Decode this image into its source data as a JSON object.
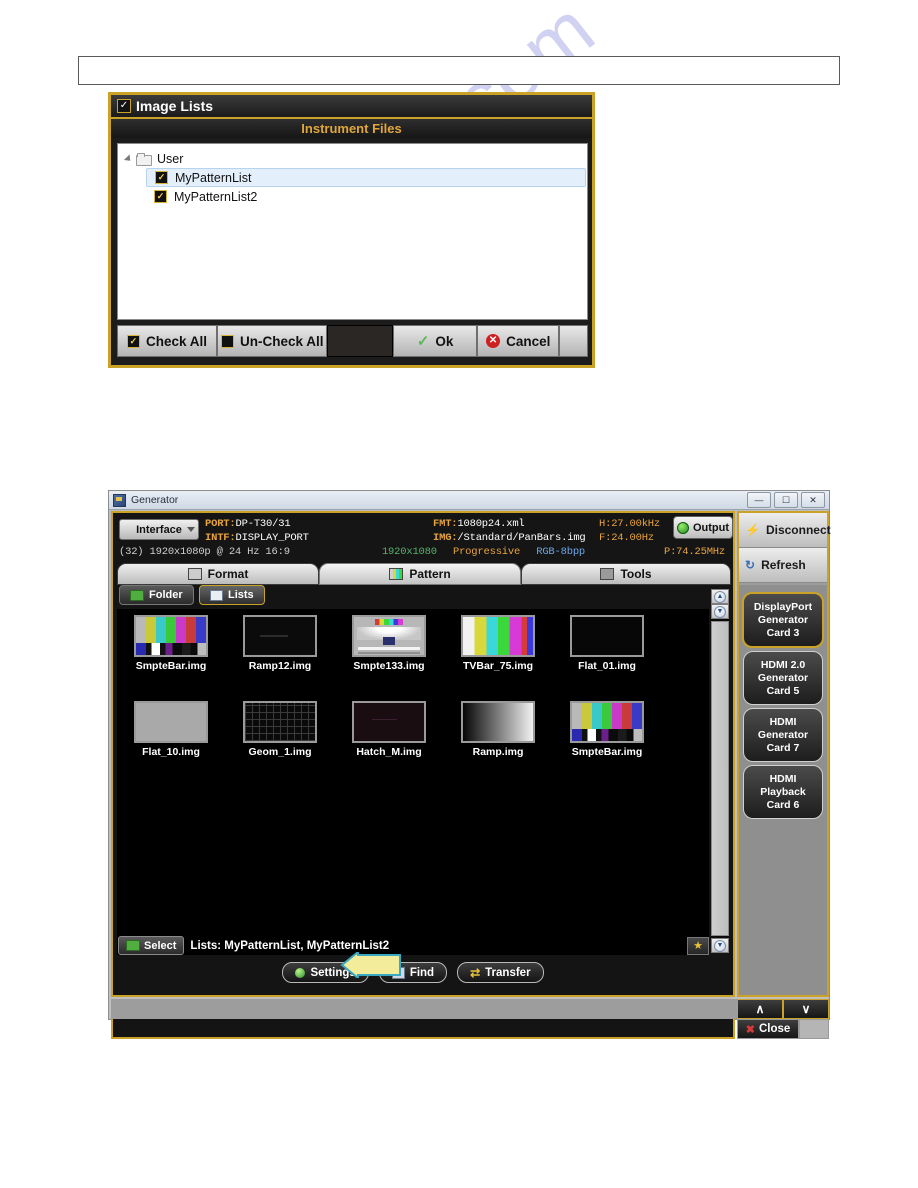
{
  "watermark": {
    "text": "manualzz.com"
  },
  "dialog": {
    "title": "Image Lists",
    "title_checkbox": "checked",
    "subtitle": "Instrument Files",
    "tree": {
      "root_label": "User",
      "items": [
        {
          "label": "MyPatternList",
          "checked": true,
          "selected": true
        },
        {
          "label": "MyPatternList2",
          "checked": true,
          "selected": false
        }
      ]
    },
    "buttons": {
      "check_all": "Check All",
      "uncheck_all": "Un-Check All",
      "ok": "Ok",
      "cancel": "Cancel"
    }
  },
  "generator": {
    "window_title": "Generator",
    "window_controls": {
      "minimize": "—",
      "maximize": "□",
      "close": "✕"
    },
    "interface_button": "Interface",
    "info": {
      "port_key": "PORT:",
      "port_value": "DP-T30/31",
      "intf_key": "INTF:",
      "intf_value": "DISPLAY_PORT",
      "fmt_key": "FMT:",
      "fmt_value": "1080p24.xml",
      "img_key": "IMG:",
      "img_value": "/Standard/PanBars.img",
      "h_freq": "H:27.00kHz",
      "f_freq": "F:24.00Hz",
      "pixel_clock": "P:74.25MHz",
      "output_button": "Output"
    },
    "status_line": {
      "index": "(32)",
      "timing": "1920x1080p @ 24 Hz 16:9",
      "resolution": "1920x1080",
      "scan": "Progressive",
      "color": "RGB-8bpp"
    },
    "tabs": [
      {
        "label": "Format",
        "active": false,
        "icon": "monitor-icon"
      },
      {
        "label": "Pattern",
        "active": true,
        "icon": "color-bars-icon"
      },
      {
        "label": "Tools",
        "active": false,
        "icon": "tools-icon"
      }
    ],
    "subtabs": [
      {
        "label": "Folder",
        "selected": false,
        "icon": "folder-icon"
      },
      {
        "label": "Lists",
        "selected": true,
        "icon": "list-icon"
      }
    ],
    "thumbnails": [
      {
        "label": "SmpteBar.img",
        "style": "smpte"
      },
      {
        "label": "Ramp12.img",
        "style": "ramp12"
      },
      {
        "label": "Smpte133.img",
        "style": "smpte133"
      },
      {
        "label": "TVBar_75.img",
        "style": "tvbar"
      },
      {
        "label": "Flat_01.img",
        "style": "flat01"
      },
      {
        "label": "Flat_10.img",
        "style": "flat10"
      },
      {
        "label": "Geom_1.img",
        "style": "geom"
      },
      {
        "label": "Hatch_M.img",
        "style": "hatch"
      },
      {
        "label": "Ramp.img",
        "style": "ramp"
      },
      {
        "label": "SmpteBar.img",
        "style": "smpte"
      }
    ],
    "select_bar": {
      "select_button": "Select",
      "lists_text": "Lists: MyPatternList, MyPatternList2",
      "favorite_icon": "star-icon"
    },
    "actions": [
      {
        "label": "Settings",
        "icon": "gear-icon"
      },
      {
        "label": "Find",
        "icon": "magnifier-icon"
      },
      {
        "label": "Transfer",
        "icon": "transfer-icon"
      }
    ],
    "rail": {
      "disconnect": "Disconnect",
      "refresh": "Refresh",
      "cards": [
        {
          "line1": "DisplayPort",
          "line2": "Generator",
          "line3": "Card 3",
          "selected": true
        },
        {
          "line1": "HDMI 2.0",
          "line2": "Generator",
          "line3": "Card 5",
          "selected": false
        },
        {
          "line1": "HDMI",
          "line2": "Generator",
          "line3": "Card 7",
          "selected": false
        },
        {
          "line1": "HDMI",
          "line2": "Playback",
          "line3": "Card 6",
          "selected": false
        }
      ],
      "nav_up": "∧",
      "nav_down": "∨",
      "close": "Close"
    }
  },
  "colors": {
    "accent_gold": "#c9a227",
    "panel_black": "#141414",
    "key_orange": "#e8a33d",
    "callout_yellow": "#f2ec9b",
    "callout_border": "#3aa8c1"
  }
}
